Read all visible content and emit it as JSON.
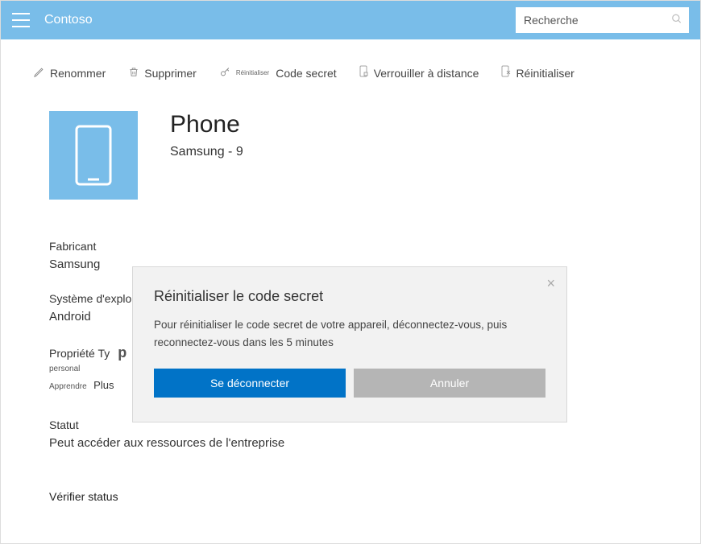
{
  "header": {
    "brand": "Contoso",
    "search_placeholder": "Recherche"
  },
  "toolbar": {
    "rename": "Renommer",
    "delete": "Supprimer",
    "reset_tiny": "Réinitialiser",
    "passcode": "Code secret",
    "remote_lock": "Verrouiller à distance",
    "reset": "Réinitialiser"
  },
  "device": {
    "name": "Phone",
    "subtitle": "Samsung - 9"
  },
  "meta": {
    "manufacturer_label": "Fabricant",
    "manufacturer_value": "Samsung",
    "os_label": "Système d'exploitation",
    "os_value": "Android",
    "ownership_label": "Propriété Ty",
    "ownership_p": "p",
    "ownership_value": "personal",
    "learn": "Apprendre",
    "plus": "Plus",
    "status_label": "Statut",
    "status_value": "Peut accéder aux ressources de l'entreprise",
    "verify": "Vérifier status"
  },
  "modal": {
    "title": "Réinitialiser le code secret",
    "message": "Pour réinitialiser le code secret de votre appareil, déconnectez-vous, puis reconnectez-vous dans les 5 minutes",
    "primary": "Se déconnecter",
    "secondary": "Annuler"
  }
}
